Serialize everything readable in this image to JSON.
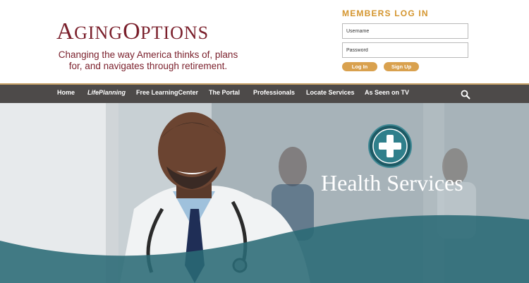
{
  "header": {
    "logo_prefix_big": "A",
    "logo_prefix_small": "GING",
    "logo_suffix_big": "O",
    "logo_suffix_small": "PTIONS",
    "tagline": "Changing the way America thinks of, plans for, and navigates through retirement."
  },
  "login": {
    "title": "MEMBERS LOG IN",
    "username_placeholder": "Username",
    "password_placeholder": "Password",
    "login_label": "Log In",
    "signup_label": "Sign Up"
  },
  "nav": {
    "items": [
      {
        "label": "Home"
      },
      {
        "label": "LifePlanning"
      },
      {
        "label": "Free LearningCenter"
      },
      {
        "label": "The Portal"
      },
      {
        "label": "Professionals"
      },
      {
        "label": "Locate Services"
      },
      {
        "label": "As Seen on TV"
      }
    ],
    "search_icon": "search-icon"
  },
  "hero": {
    "title": "Health Services",
    "badge_icon": "plus-icon"
  },
  "colors": {
    "brand": "#7a1f2b",
    "accent": "#d4952e",
    "nav_bg": "#4d4a49",
    "wave": "#2a6a75"
  }
}
